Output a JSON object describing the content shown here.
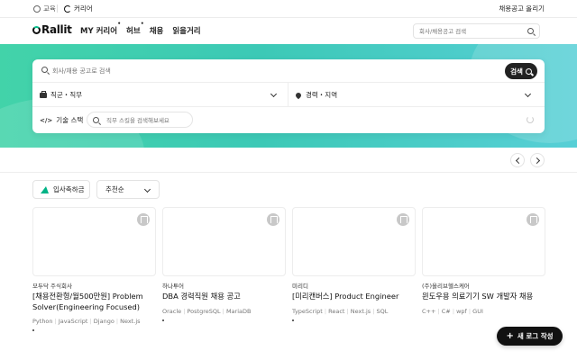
{
  "topbar": {
    "education_label": "교육",
    "career_label": "커리어",
    "post_job_label": "채용공고 올리기"
  },
  "gnb": {
    "logo_text": "Rallit",
    "nav": [
      "MY 커리어",
      "허브",
      "채용",
      "읽을거리"
    ],
    "search_placeholder": "회사/채용공고 검색"
  },
  "search_card": {
    "keyword_placeholder": "회사/채용 공고로 검색",
    "search_button_label": "검색",
    "job_filter_label": "직군・직무",
    "location_filter_label": "경력・지역",
    "skill_label": "기술 스택",
    "skill_placeholder": "직무 스킬을 검색해보세요"
  },
  "filters": {
    "celebrate_label": "입사축하금",
    "sort_label": "추천순"
  },
  "jobs": [
    {
      "company": "모두닥 주식회사",
      "title": "[채용전환형/월500만원] Problem Solver(Engineering Focused)",
      "tags": [
        "Python",
        "JavaScript",
        "Django",
        "Next.js"
      ]
    },
    {
      "company": "하나투어",
      "title": "DBA 경력직원 채용 공고",
      "tags": [
        "Oracle",
        "PostgreSQL",
        "MariaDB"
      ]
    },
    {
      "company": "미리디",
      "title": "[미리캔버스] Product Engineer",
      "tags": [
        "TypeScript",
        "React",
        "Next.js",
        "SQL"
      ]
    },
    {
      "company": "(주)올리브헬스케어",
      "title": "윈도우용 의료기기 SW 개발자 채용",
      "tags": [
        "C++",
        "C#",
        "wpf",
        "GUI"
      ]
    }
  ],
  "fab": {
    "label": "새 로그 작성"
  },
  "colors": {
    "brand": "#00c08b",
    "hero_start": "#42d3a9",
    "hero_end": "#57cfd6",
    "dark": "#111111"
  }
}
